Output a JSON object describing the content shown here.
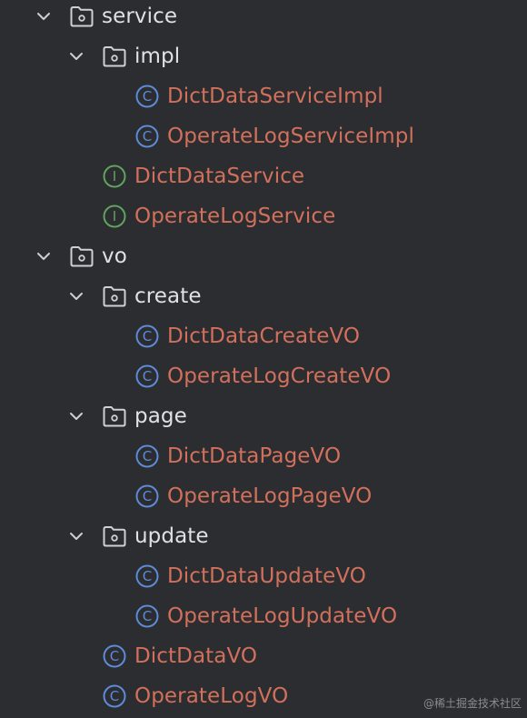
{
  "colors": {
    "background": "#2b2d30",
    "folder_text": "#dfe1e5",
    "class_text": "#d2705c",
    "icon_stroke": "#ced0d6",
    "class_icon": "#5e8ad6",
    "interface_icon": "#5fa35f"
  },
  "tree": {
    "rows": [
      {
        "label": "service",
        "kind": "folder",
        "depth": 0,
        "expanded": true,
        "icon": "folder-icon"
      },
      {
        "label": "impl",
        "kind": "folder",
        "depth": 1,
        "expanded": true,
        "icon": "folder-icon"
      },
      {
        "label": "DictDataServiceImpl",
        "kind": "class",
        "depth": 2,
        "icon": "class-icon",
        "icon_letter": "C"
      },
      {
        "label": "OperateLogServiceImpl",
        "kind": "class",
        "depth": 2,
        "icon": "class-icon",
        "icon_letter": "C"
      },
      {
        "label": "DictDataService",
        "kind": "interface",
        "depth": 1,
        "icon": "interface-icon",
        "icon_letter": "I"
      },
      {
        "label": "OperateLogService",
        "kind": "interface",
        "depth": 1,
        "icon": "interface-icon",
        "icon_letter": "I"
      },
      {
        "label": "vo",
        "kind": "folder",
        "depth": 0,
        "expanded": true,
        "icon": "folder-icon"
      },
      {
        "label": "create",
        "kind": "folder",
        "depth": 1,
        "expanded": true,
        "icon": "folder-icon"
      },
      {
        "label": "DictDataCreateVO",
        "kind": "class",
        "depth": 2,
        "icon": "class-icon",
        "icon_letter": "C"
      },
      {
        "label": "OperateLogCreateVO",
        "kind": "class",
        "depth": 2,
        "icon": "class-icon",
        "icon_letter": "C"
      },
      {
        "label": "page",
        "kind": "folder",
        "depth": 1,
        "expanded": true,
        "icon": "folder-icon"
      },
      {
        "label": "DictDataPageVO",
        "kind": "class",
        "depth": 2,
        "icon": "class-icon",
        "icon_letter": "C"
      },
      {
        "label": "OperateLogPageVO",
        "kind": "class",
        "depth": 2,
        "icon": "class-icon",
        "icon_letter": "C"
      },
      {
        "label": "update",
        "kind": "folder",
        "depth": 1,
        "expanded": true,
        "icon": "folder-icon"
      },
      {
        "label": "DictDataUpdateVO",
        "kind": "class",
        "depth": 2,
        "icon": "class-icon",
        "icon_letter": "C"
      },
      {
        "label": "OperateLogUpdateVO",
        "kind": "class",
        "depth": 2,
        "icon": "class-icon",
        "icon_letter": "C"
      },
      {
        "label": "DictDataVO",
        "kind": "class",
        "depth": 1,
        "icon": "class-icon",
        "icon_letter": "C"
      },
      {
        "label": "OperateLogVO",
        "kind": "class",
        "depth": 1,
        "icon": "class-icon",
        "icon_letter": "C"
      }
    ]
  },
  "watermark": {
    "text": "@稀土掘金技术社区"
  }
}
